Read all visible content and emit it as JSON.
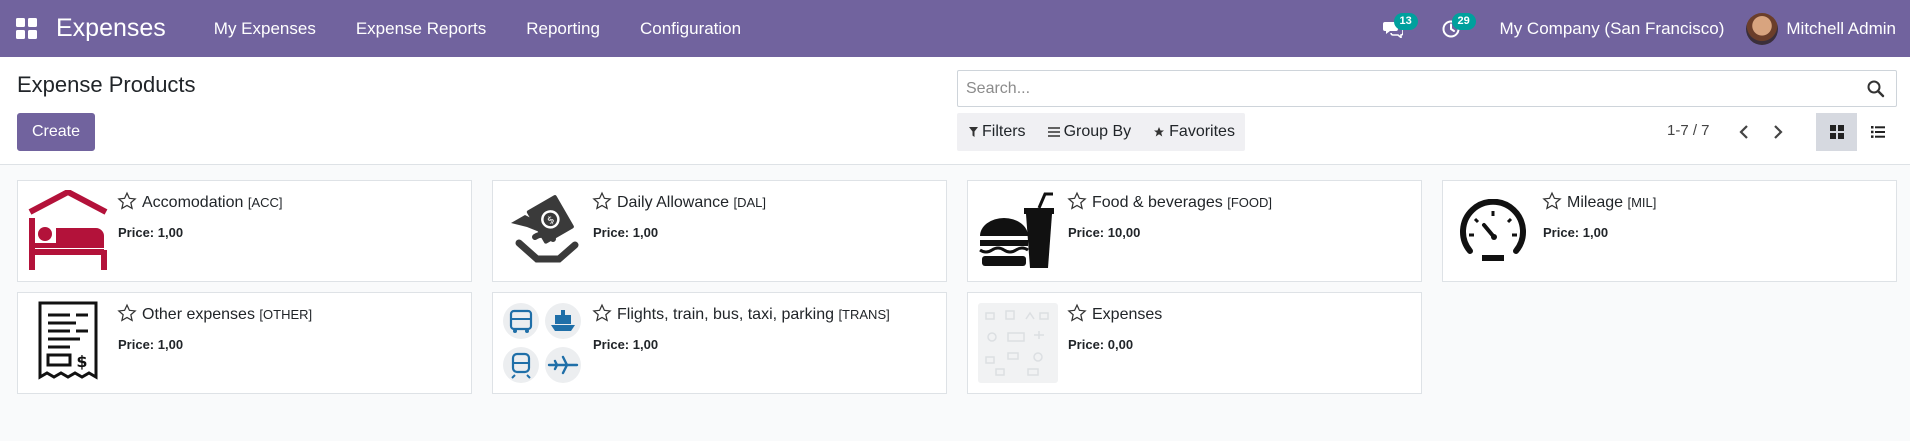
{
  "app": {
    "title": "Expenses",
    "menu": [
      "My Expenses",
      "Expense Reports",
      "Reporting",
      "Configuration"
    ],
    "messages_count": "13",
    "activities_count": "29",
    "company": "My Company (San Francisco)",
    "user": "Mitchell Admin"
  },
  "control_panel": {
    "title": "Expense Products",
    "create_label": "Create",
    "search_placeholder": "Search...",
    "filters_label": "Filters",
    "group_by_label": "Group By",
    "favorites_label": "Favorites",
    "pager": "1-7 / 7"
  },
  "products": [
    {
      "name": "Accomodation",
      "code": "[ACC]",
      "price_label": "Price:",
      "price": "1,00",
      "icon": "hotel-bed-icon"
    },
    {
      "name": "Daily Allowance",
      "code": "[DAL]",
      "price_label": "Price:",
      "price": "1,00",
      "icon": "money-hand-icon"
    },
    {
      "name": "Food & beverages",
      "code": "[FOOD]",
      "price_label": "Price:",
      "price": "10,00",
      "icon": "burger-drink-icon"
    },
    {
      "name": "Mileage",
      "code": "[MIL]",
      "price_label": "Price:",
      "price": "1,00",
      "icon": "speedometer-icon"
    },
    {
      "name": "Other expenses",
      "code": "[OTHER]",
      "price_label": "Price:",
      "price": "1,00",
      "icon": "receipt-icon"
    },
    {
      "name": "Flights, train, bus, taxi, parking",
      "code": "[TRANS]",
      "price_label": "Price:",
      "price": "1,00",
      "icon": "transport-icons"
    },
    {
      "name": "Expenses",
      "code": "",
      "price_label": "Price:",
      "price": "0,00",
      "icon": "placeholder-image-icon"
    }
  ],
  "colors": {
    "navbar": "#71639e",
    "badge": "#00a09d",
    "accomodation_icon": "#b3123a",
    "transport_icon": "#1f6fa8"
  }
}
